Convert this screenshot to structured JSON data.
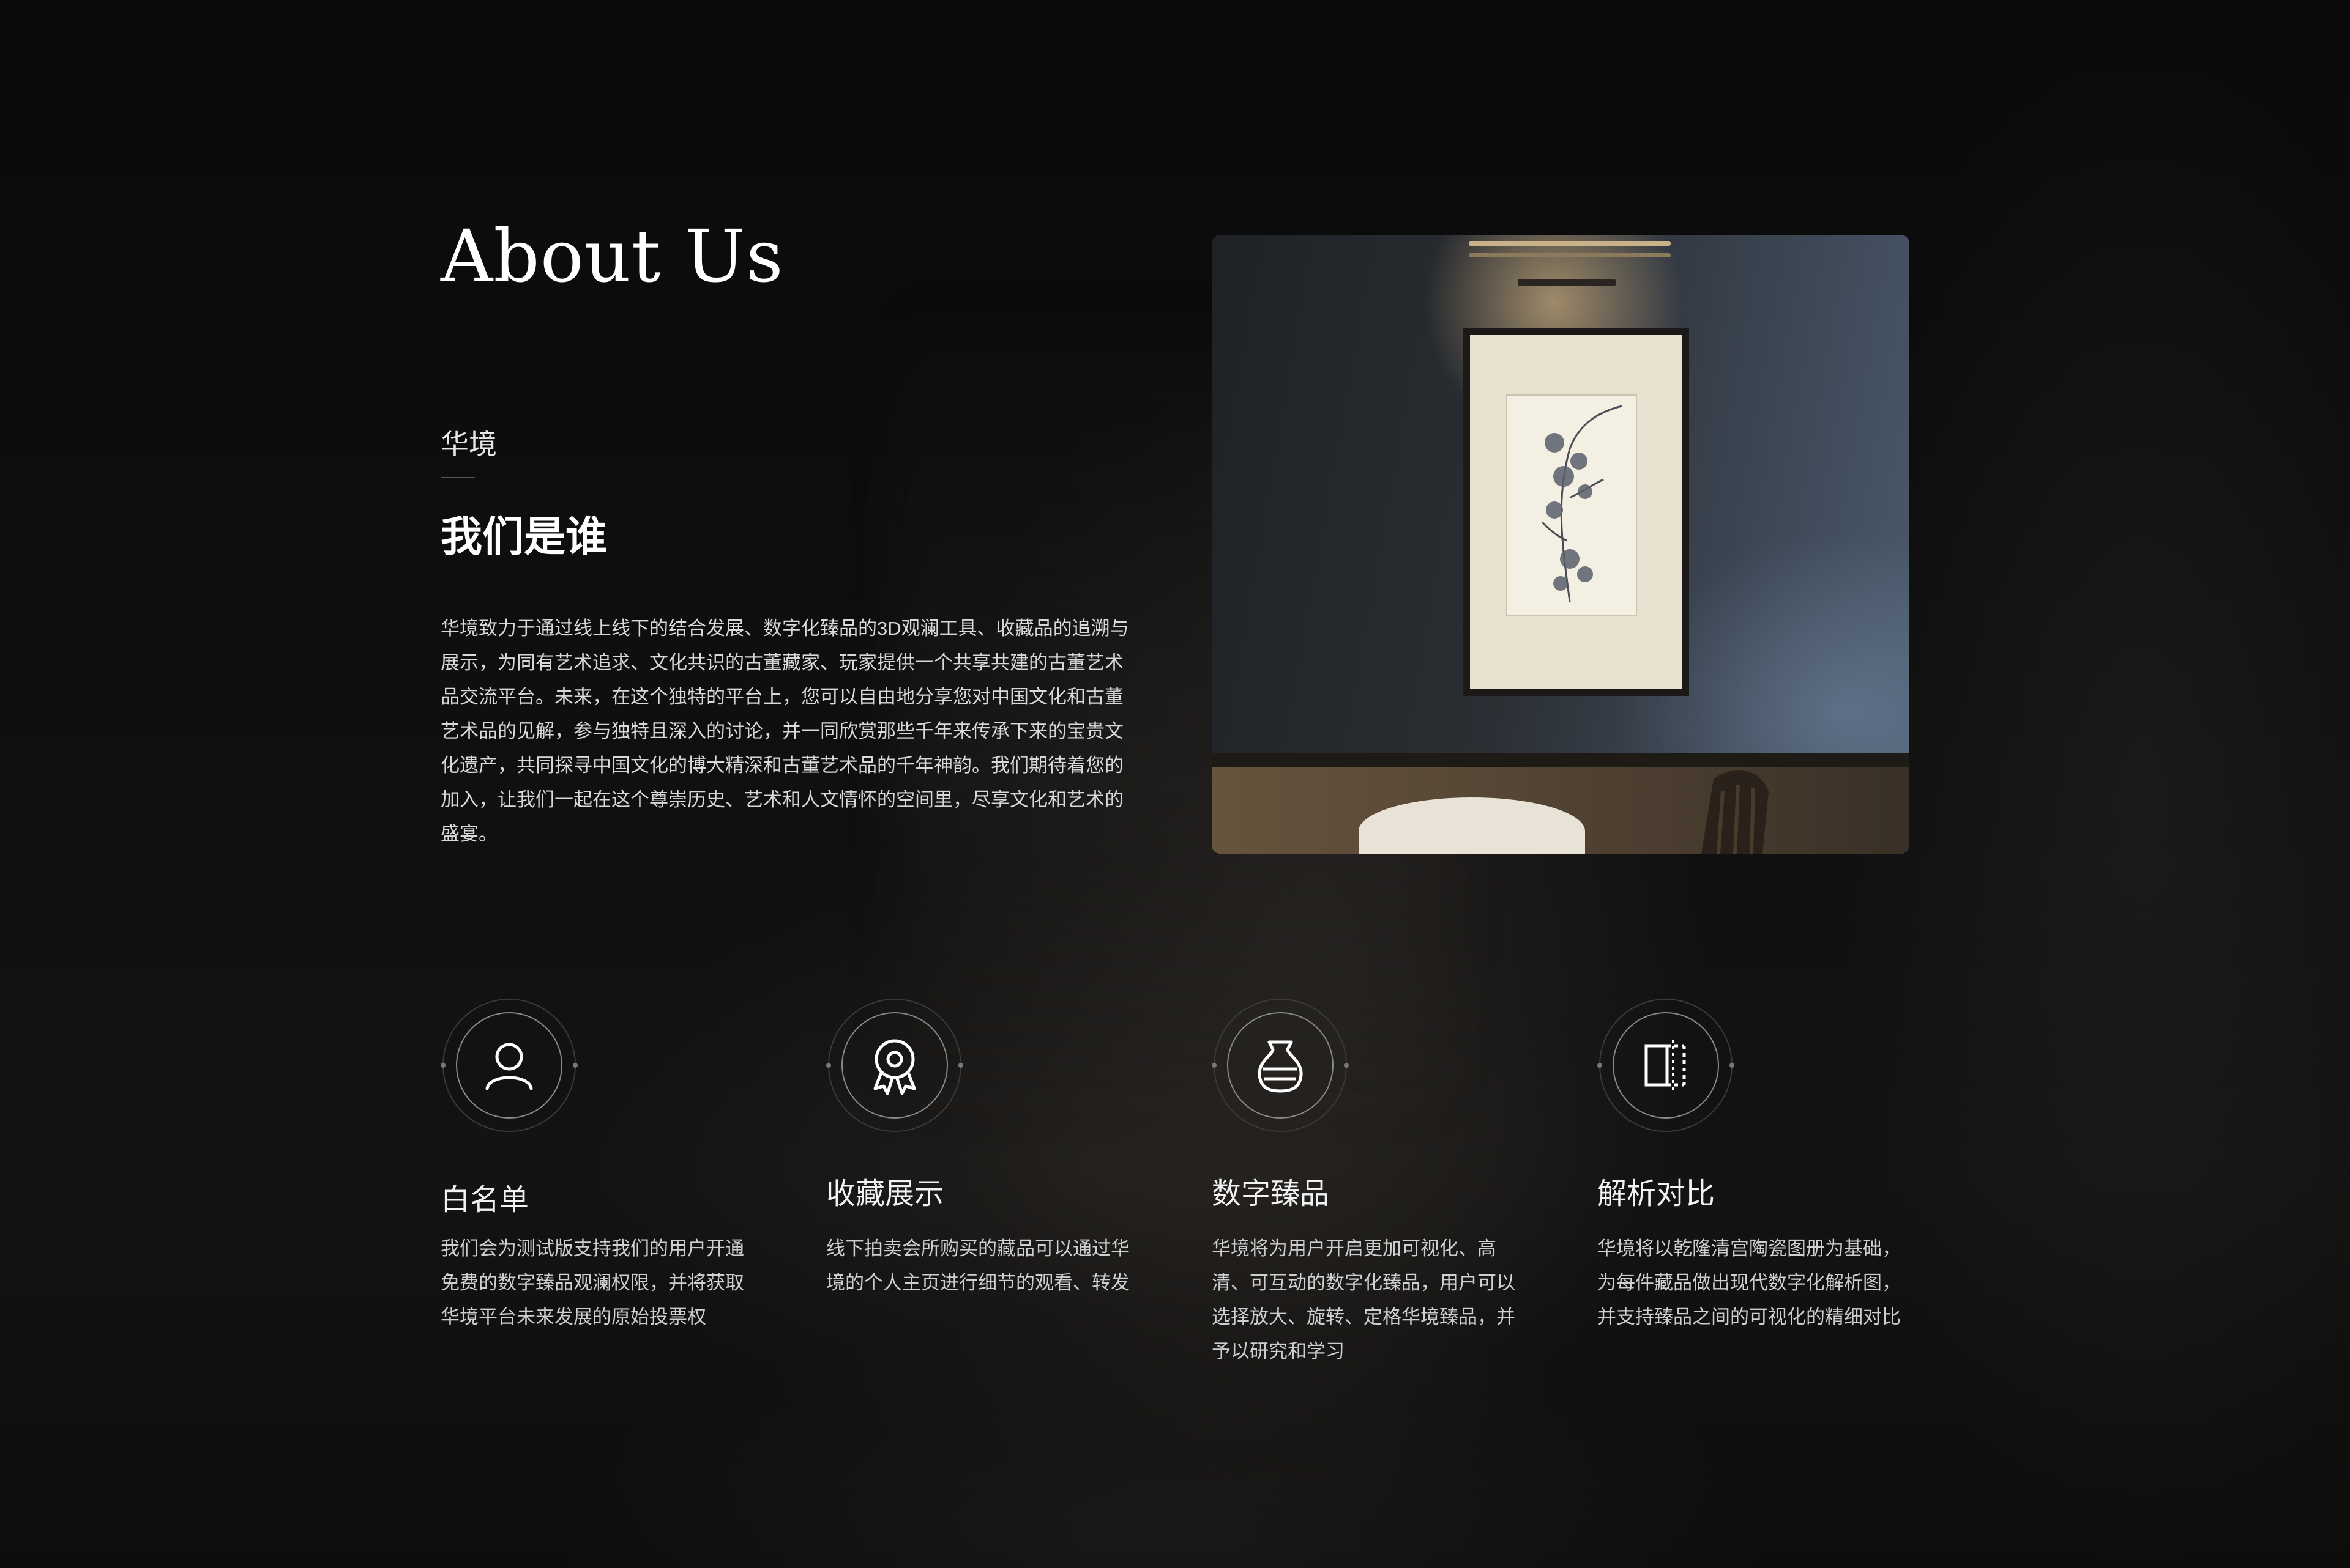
{
  "page": {
    "title": "About Us",
    "eyebrow": "华境",
    "heading": "我们是谁",
    "intro": "华境致力于通过线上线下的结合发展、数字化臻品的3D观澜工具、收藏品的追溯与展示，为同有艺术追求、文化共识的古董藏家、玩家提供一个共享共建的古董艺术品交流平台。未来，在这个独特的平台上，您可以自由地分享您对中国文化和古董艺术品的见解，参与独特且深入的讨论，并一同欣赏那些千年来传承下来的宝贵文化遗产，共同探寻中国文化的博大精深和古董艺术品的千年神韵。我们期待着您的加入，让我们一起在这个尊崇历史、艺术和人文情怀的空间里，尽享文化和艺术的盛宴。"
  },
  "hero_image": {
    "icon": "framed-flower-sketch-photo"
  },
  "colors": {
    "background": "#0b0b0b",
    "text_primary": "#ffffff",
    "text_secondary": "#d9d9d9",
    "icon_ring": "#8a8a8a"
  },
  "features": [
    {
      "icon": "user-icon",
      "title": "白名单",
      "description": "我们会为测试版支持我们的用户开通免费的数字臻品观澜权限，并将获取华境平台未来发展的原始投票权"
    },
    {
      "icon": "badge-icon",
      "title": "收藏展示",
      "description": "线下拍卖会所购买的藏品可以通过华境的个人主页进行细节的观看、转发"
    },
    {
      "icon": "vase-icon",
      "title": "数字臻品",
      "description": "华境将为用户开启更加可视化、高清、可互动的数字化臻品，用户可以选择放大、旋转、定格华境臻品，并予以研究和学习"
    },
    {
      "icon": "compare-icon",
      "title": "解析对比",
      "description": "华境将以乾隆清宫陶瓷图册为基础，为每件藏品做出现代数字化解析图，并支持臻品之间的可视化的精细对比"
    }
  ]
}
